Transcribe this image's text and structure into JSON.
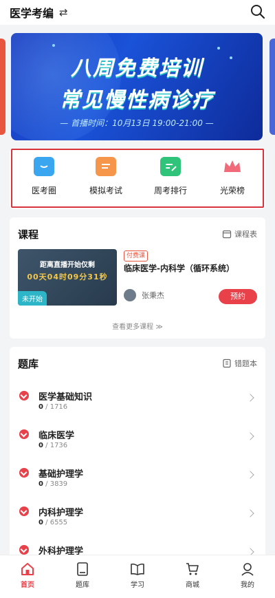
{
  "header": {
    "title": "医学考编",
    "swap_glyph": "⇄"
  },
  "banner": {
    "line1": "八周免费培训",
    "line2": "常见慢性病诊疗",
    "line3": "— 首播时间：10月13日 19:00-21:00 —"
  },
  "quick_nav": [
    {
      "label": "医考圈",
      "icon": "chat-bubble-icon",
      "color": "#3aa6f0"
    },
    {
      "label": "模拟考试",
      "icon": "document-icon",
      "color": "#f5964a"
    },
    {
      "label": "周考排行",
      "icon": "edit-note-icon",
      "color": "#2fc47a"
    },
    {
      "label": "光荣榜",
      "icon": "crown-icon",
      "color": "#f06a7a"
    }
  ],
  "course": {
    "title": "课程",
    "schedule_link": "课程表",
    "thumb_line1": "距离直播开始仅剩",
    "thumb_line2": "00天04时09分31秒",
    "thumb_tag": "未开始",
    "paid_tag": "付费课",
    "name": "临床医学-内科学（循环系统）",
    "teacher": "张秉杰",
    "reserve_label": "预约",
    "more_label": "查看更多课程 ≫"
  },
  "bank": {
    "title": "题库",
    "wrong_link": "错题本",
    "items": [
      {
        "name": "医学基础知识",
        "done": "0",
        "total": "/ 1716"
      },
      {
        "name": "临床医学",
        "done": "0",
        "total": "/ 1736"
      },
      {
        "name": "基础护理学",
        "done": "0",
        "total": "/ 3839"
      },
      {
        "name": "内科护理学",
        "done": "0",
        "total": "/ 6555"
      },
      {
        "name": "外科护理学",
        "done": "",
        "total": ""
      }
    ]
  },
  "tabs": [
    {
      "label": "首页",
      "icon": "home-icon",
      "active": true
    },
    {
      "label": "题库",
      "icon": "book-icon",
      "active": false
    },
    {
      "label": "学习",
      "icon": "open-book-icon",
      "active": false
    },
    {
      "label": "商城",
      "icon": "cart-icon",
      "active": false
    },
    {
      "label": "我的",
      "icon": "person-icon",
      "active": false
    }
  ],
  "colors": {
    "accent": "#e8414a",
    "banner_blue": "#1a52d8",
    "highlight_box": "#d8323a"
  }
}
